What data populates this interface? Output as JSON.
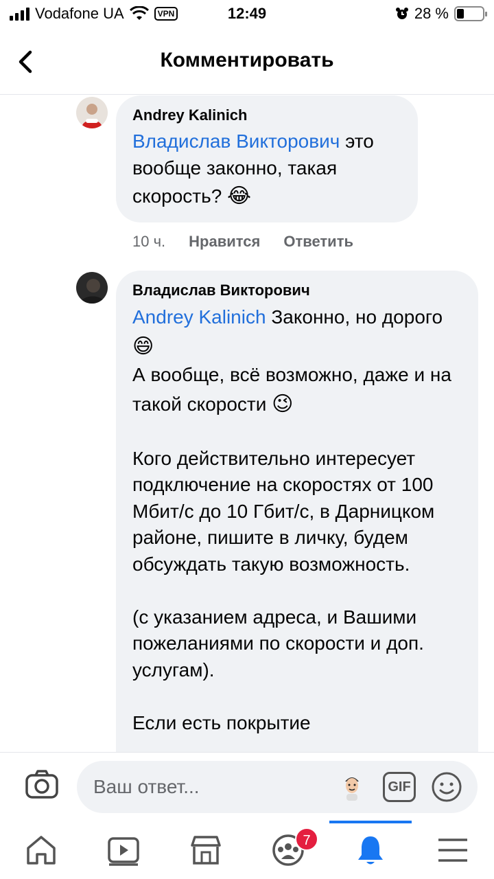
{
  "status_bar": {
    "carrier": "Vodafone UA",
    "vpn": "VPN",
    "time": "12:49",
    "battery_text": "28 %",
    "battery_level": 0.28
  },
  "header": {
    "title": "Комментировать"
  },
  "comments": [
    {
      "author": "Andrey Kalinich",
      "mention": "Владислав Викторович",
      "text": " это вообще законно, такая скорость? ",
      "emoji": "😂",
      "time": "10 ч.",
      "like_label": "Нравится",
      "reply_label": "Ответить"
    },
    {
      "author": "Владислав Викторович",
      "mention": "Andrey Kalinich",
      "line1": " Законно, но дорого ",
      "emoji1": "😄",
      "line2": "А вообще, всё возможно, даже и на такой скорости ",
      "emoji2": "😉",
      "para2": "Кого действительно интересует подключение на скоростях от 100 Мбит/с до 10 Гбит/с, в Дарницком районе, пишите в личку, будем обсуждать такую возможность.",
      "para3": "(с указанием адреса, и Вашими пожеланиями по скорости и доп. услугам).",
      "para4": "Если есть покрытие"
    }
  ],
  "reply_bar": {
    "placeholder": "Ваш ответ...",
    "gif_label": "GIF"
  },
  "tab_bar": {
    "badge_count": "7",
    "accent": "#1877f2"
  },
  "colors": {
    "mention": "#216fdb",
    "bubble": "#f0f2f5",
    "badge": "#e41e3f"
  }
}
